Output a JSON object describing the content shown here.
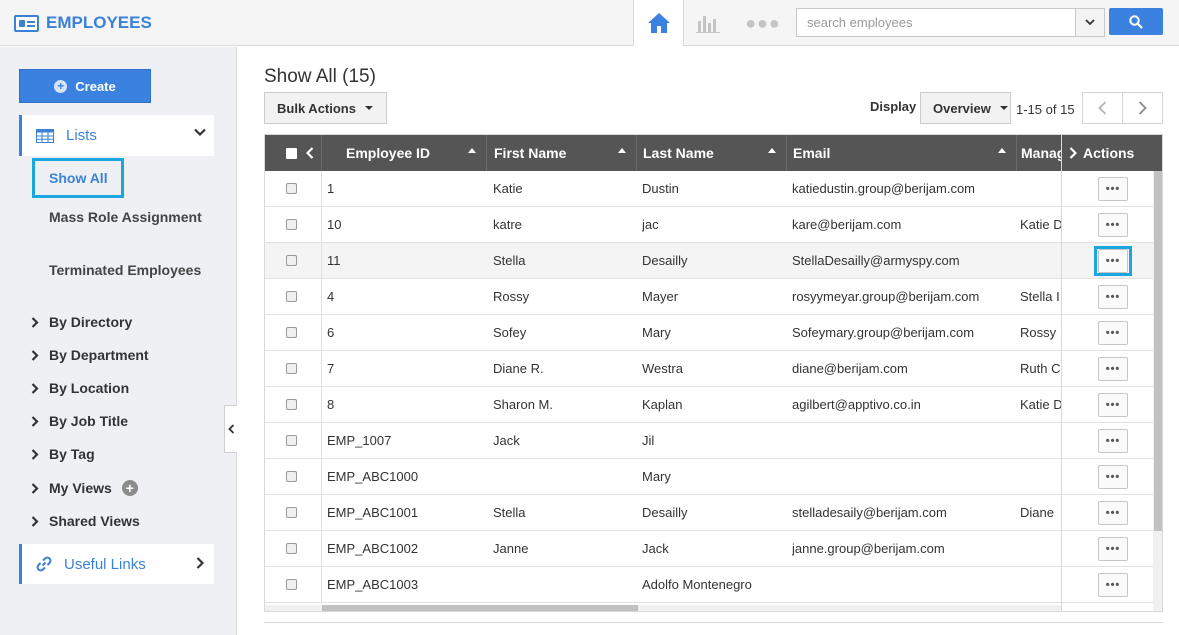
{
  "app": {
    "title": "EMPLOYEES"
  },
  "search": {
    "placeholder": "search employees"
  },
  "sidebar": {
    "create_label": "Create",
    "lists_label": "Lists",
    "show_all": "Show All",
    "sub_items": [
      "Mass Role Assignment",
      "Terminated Employees"
    ],
    "groups": [
      "By Directory",
      "By Department",
      "By Location",
      "By Job Title",
      "By Tag",
      "My Views",
      "Shared Views"
    ],
    "useful_links": "Useful Links"
  },
  "main": {
    "title": "Show All (15)",
    "bulk_actions": "Bulk Actions",
    "display_label": "Display",
    "display_value": "Overview",
    "pager_text": "1-15 of 15"
  },
  "grid": {
    "columns": [
      "Employee ID",
      "First Name",
      "Last Name",
      "Email",
      "Manag",
      "Actions"
    ],
    "action_glyph": "•••",
    "rows": [
      {
        "id": "1",
        "first": "Katie",
        "last": "Dustin",
        "email": "katiedustin.group@berijam.com",
        "manager": ""
      },
      {
        "id": "10",
        "first": "katre",
        "last": "jac",
        "email": "kare@berijam.com",
        "manager": "Katie D"
      },
      {
        "id": "11",
        "first": "Stella",
        "last": "Desailly",
        "email": "StellaDesailly@armyspy.com",
        "manager": ""
      },
      {
        "id": "4",
        "first": "Rossy",
        "last": "Mayer",
        "email": "rosyymeyar.group@berijam.com",
        "manager": "Stella I"
      },
      {
        "id": "6",
        "first": "Sofey",
        "last": "Mary",
        "email": "Sofeymary.group@berijam.com",
        "manager": "Rossy"
      },
      {
        "id": "7",
        "first": "Diane R.",
        "last": "Westra",
        "email": "diane@berijam.com",
        "manager": "Ruth C"
      },
      {
        "id": "8",
        "first": "Sharon M.",
        "last": "Kaplan",
        "email": "agilbert@apptivo.co.in",
        "manager": "Katie D"
      },
      {
        "id": "EMP_1007",
        "first": "Jack",
        "last": "Jil",
        "email": "",
        "manager": ""
      },
      {
        "id": "EMP_ABC1000",
        "first": "",
        "last": "Mary",
        "email": "",
        "manager": ""
      },
      {
        "id": "EMP_ABC1001",
        "first": "Stella",
        "last": "Desailly",
        "email": "stelladesaily@berijam.com",
        "manager": "Diane"
      },
      {
        "id": "EMP_ABC1002",
        "first": "Janne",
        "last": "Jack",
        "email": "janne.group@berijam.com",
        "manager": ""
      },
      {
        "id": "EMP_ABC1003",
        "first": "",
        "last": "Adolfo Montenegro",
        "email": "",
        "manager": ""
      }
    ]
  },
  "colors": {
    "accent": "#3b82e0",
    "highlight": "#1aa6df",
    "header_bg": "#555555"
  }
}
